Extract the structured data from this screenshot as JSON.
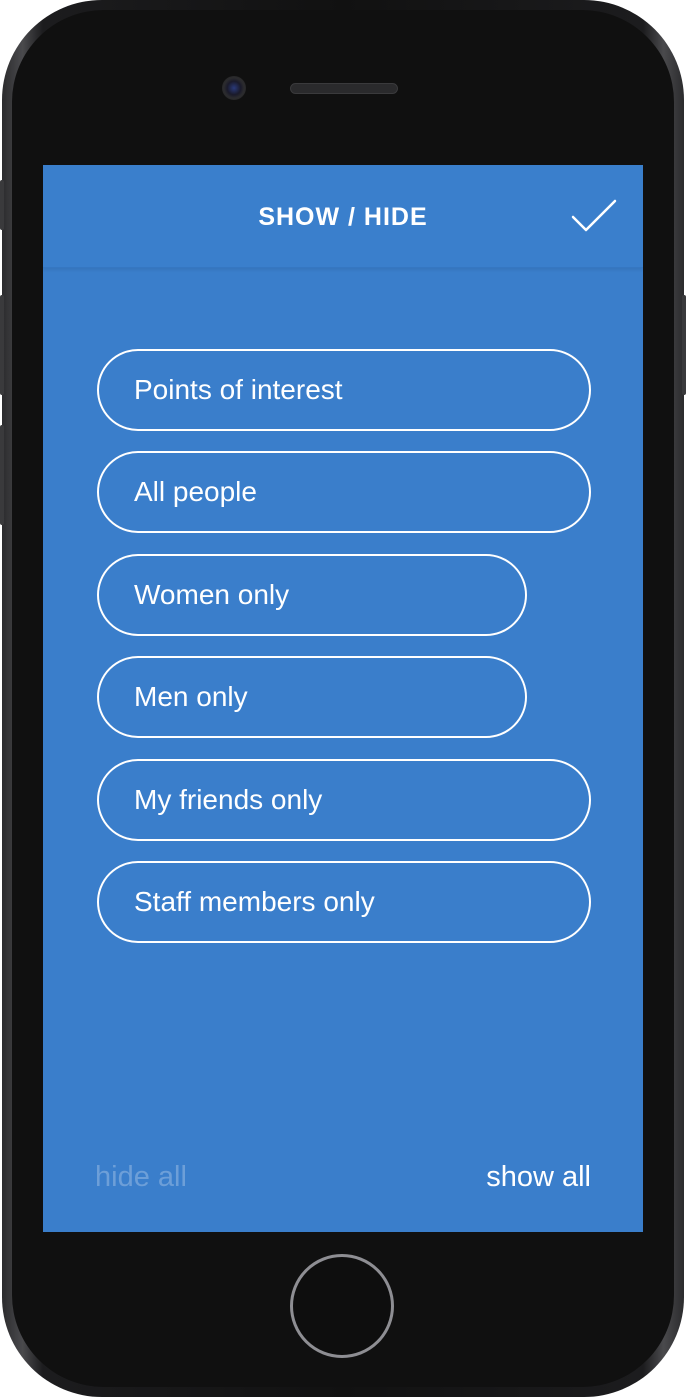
{
  "header": {
    "title": "SHOW / HIDE",
    "confirm_icon": "check-icon"
  },
  "filters": [
    {
      "label": "Points of interest"
    },
    {
      "label": "All people"
    },
    {
      "label": "Women only"
    },
    {
      "label": "Men only"
    },
    {
      "label": "My friends only"
    },
    {
      "label": "Staff members only"
    }
  ],
  "footer": {
    "hide_all": "hide all",
    "show_all": "show all"
  },
  "colors": {
    "background": "#3a7ecb",
    "text": "#ffffff",
    "disabled_text": "#6d9fd8"
  }
}
